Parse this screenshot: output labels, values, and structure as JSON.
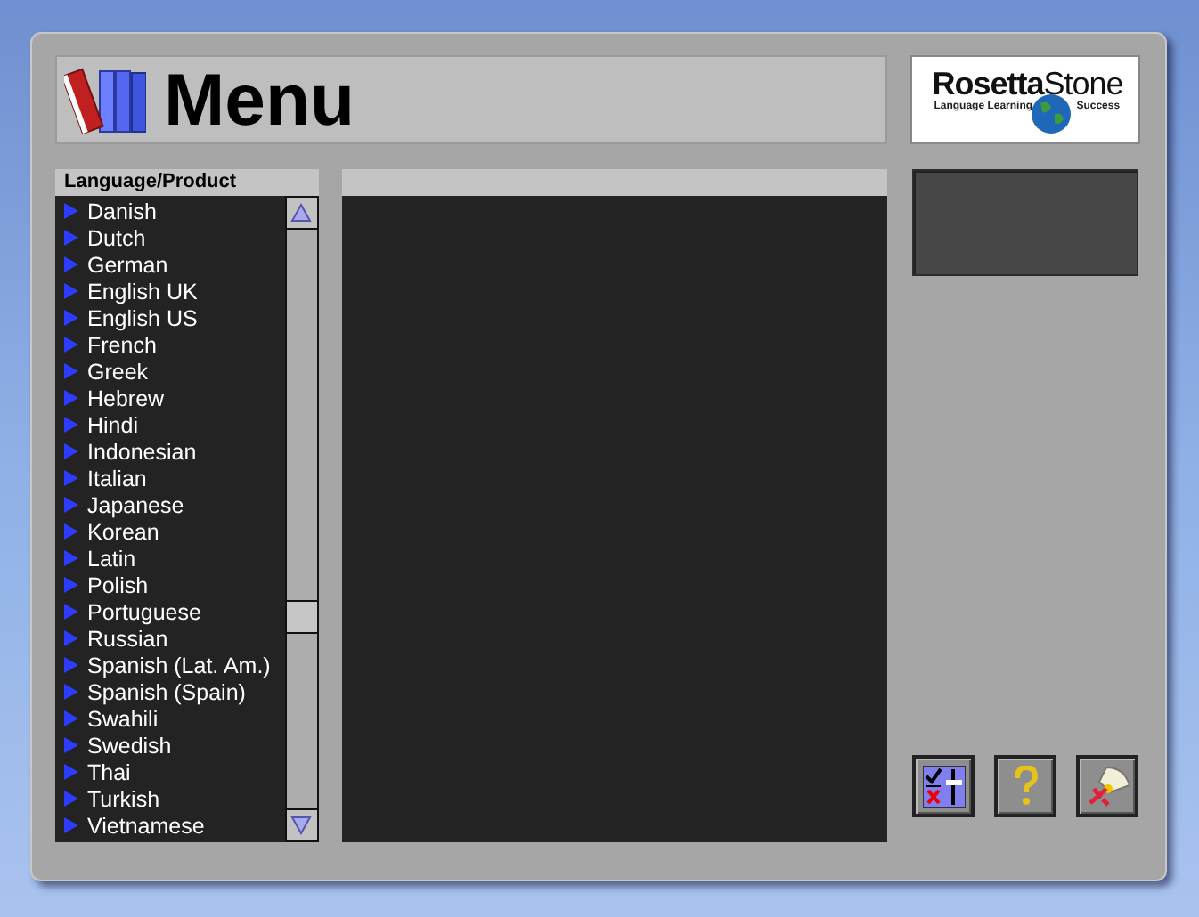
{
  "header": {
    "title": "Menu"
  },
  "logo": {
    "brand_left": "Rosetta",
    "brand_right": "Stone",
    "tagline_left": "Language Learning",
    "tagline_right": "Success"
  },
  "language_list": {
    "heading": "Language/Product",
    "items": [
      {
        "label": "Danish"
      },
      {
        "label": "Dutch"
      },
      {
        "label": "German"
      },
      {
        "label": "English UK"
      },
      {
        "label": "English US"
      },
      {
        "label": "French"
      },
      {
        "label": "Greek"
      },
      {
        "label": "Hebrew"
      },
      {
        "label": "Hindi"
      },
      {
        "label": "Indonesian"
      },
      {
        "label": "Italian"
      },
      {
        "label": "Japanese"
      },
      {
        "label": "Korean"
      },
      {
        "label": "Latin"
      },
      {
        "label": "Polish"
      },
      {
        "label": "Portuguese"
      },
      {
        "label": "Russian"
      },
      {
        "label": "Spanish (Lat. Am.)"
      },
      {
        "label": "Spanish (Spain)"
      },
      {
        "label": "Swahili"
      },
      {
        "label": "Swedish"
      },
      {
        "label": "Thai"
      },
      {
        "label": "Turkish"
      },
      {
        "label": "Vietnamese"
      }
    ]
  },
  "buttons": [
    {
      "kind": "preferences"
    },
    {
      "kind": "help"
    },
    {
      "kind": "exit"
    }
  ]
}
